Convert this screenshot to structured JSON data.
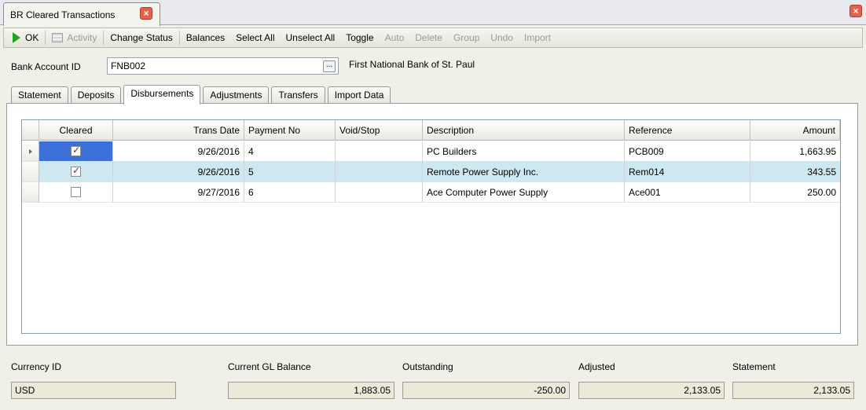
{
  "window": {
    "tab_title": "BR Cleared Transactions"
  },
  "toolbar": {
    "ok": "OK",
    "activity": "Activity",
    "change_status": "Change Status",
    "balances": "Balances",
    "select_all": "Select All",
    "unselect_all": "Unselect All",
    "toggle": "Toggle",
    "auto": "Auto",
    "delete": "Delete",
    "group": "Group",
    "undo": "Undo",
    "import": "Import"
  },
  "account": {
    "label": "Bank Account ID",
    "value": "FNB002",
    "lookup": "...",
    "bank_name": "First National Bank of St. Paul"
  },
  "tabs": [
    "Statement",
    "Deposits",
    "Disbursements",
    "Adjustments",
    "Transfers",
    "Import Data"
  ],
  "active_tab": "Disbursements",
  "grid": {
    "columns": [
      "Cleared",
      "Trans Date",
      "Payment No",
      "Void/Stop",
      "Description",
      "Reference",
      "Amount"
    ],
    "rows": [
      {
        "cleared": true,
        "trans_date": "9/26/2016",
        "payment_no": "4",
        "void_stop": "",
        "description": "PC Builders",
        "reference": "PCB009",
        "amount": "1,663.95"
      },
      {
        "cleared": true,
        "trans_date": "9/26/2016",
        "payment_no": "5",
        "void_stop": "",
        "description": "Remote Power Supply Inc.",
        "reference": "Rem014",
        "amount": "343.55"
      },
      {
        "cleared": false,
        "trans_date": "9/27/2016",
        "payment_no": "6",
        "void_stop": "",
        "description": "Ace Computer Power  Supply",
        "reference": "Ace001",
        "amount": "250.00"
      }
    ]
  },
  "footer": {
    "currency_label": "Currency ID",
    "currency_value": "USD",
    "gl_label": "Current GL Balance",
    "gl_value": "1,883.05",
    "outstanding_label": "Outstanding",
    "outstanding_value": "-250.00",
    "adjusted_label": "Adjusted",
    "adjusted_value": "2,133.05",
    "statement_label": "Statement",
    "statement_value": "2,133.05"
  }
}
